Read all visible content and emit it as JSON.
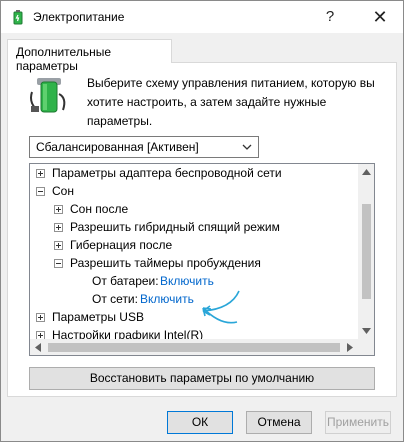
{
  "window": {
    "title": "Электропитание",
    "help_glyph": "?",
    "close_glyph": "✕"
  },
  "tab": {
    "label": "Дополнительные параметры"
  },
  "description": "Выберите схему управления питанием, которую вы хотите настроить, а затем задайте нужные параметры.",
  "scheme": {
    "selected": "Сбалансированная [Активен]"
  },
  "tree": {
    "items": [
      {
        "label": "Параметры адаптера беспроводной сети",
        "expander": "plus",
        "level": 0
      },
      {
        "label": "Сон",
        "expander": "minus",
        "level": 0
      },
      {
        "label": "Сон после",
        "expander": "plus",
        "level": 1
      },
      {
        "label": "Разрешить гибридный спящий режим",
        "expander": "plus",
        "level": 1
      },
      {
        "label": "Гибернация после",
        "expander": "plus",
        "level": 1
      },
      {
        "label": "Разрешить таймеры пробуждения",
        "expander": "minus",
        "level": 1
      },
      {
        "label": "От батареи:",
        "value": "Включить",
        "level": 2
      },
      {
        "label": "От сети:",
        "value": "Включить",
        "level": 2
      },
      {
        "label": "Параметры USB",
        "expander": "plus",
        "level": 0
      },
      {
        "label": "Настройки графики Intel(R)",
        "expander": "plus",
        "level": 0
      }
    ]
  },
  "buttons": {
    "restore": "Восстановить параметры по умолчанию",
    "ok": "ОК",
    "cancel": "Отмена",
    "apply": "Применить"
  },
  "colors": {
    "link": "#0066cc",
    "annotation_arrow": "#2aa6d8",
    "battery_green": "#2fb34a"
  }
}
